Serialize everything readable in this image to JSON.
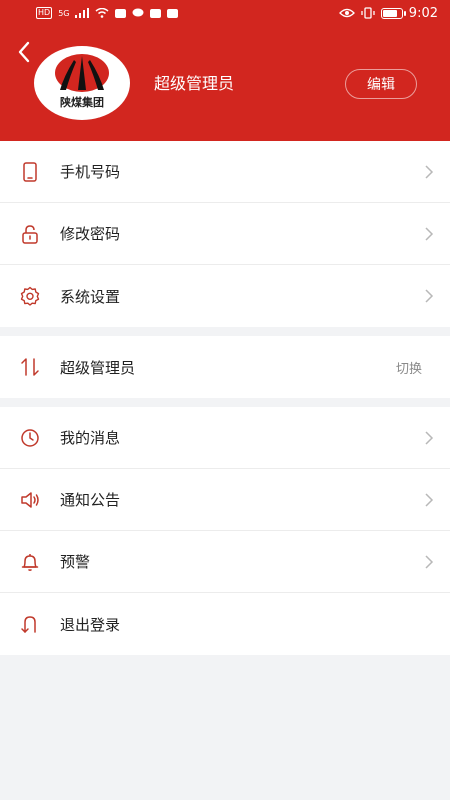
{
  "status_bar": {
    "left": [
      "HD",
      "5G"
    ],
    "time": "9:02"
  },
  "header": {
    "back_icon": "chevron-left-icon",
    "avatar_logo_text": "陕煤集团",
    "user_name": "超级管理员",
    "edit_label": "编辑"
  },
  "group1": [
    {
      "icon": "phone-icon",
      "label": "手机号码"
    },
    {
      "icon": "lock-icon",
      "label": "修改密码"
    },
    {
      "icon": "gear-icon",
      "label": "系统设置"
    }
  ],
  "group2": {
    "icon": "switch-arrows-icon",
    "label": "超级管理员",
    "action": "切换"
  },
  "group3": [
    {
      "icon": "clock-icon",
      "label": "我的消息"
    },
    {
      "icon": "speaker-icon",
      "label": "通知公告"
    },
    {
      "icon": "bell-icon",
      "label": "预警"
    },
    {
      "icon": "logout-icon",
      "label": "退出登录"
    }
  ],
  "colors": {
    "brand_red": "#d2261f",
    "icon_red": "#c0392b",
    "page_bg": "#f2f3f5"
  }
}
